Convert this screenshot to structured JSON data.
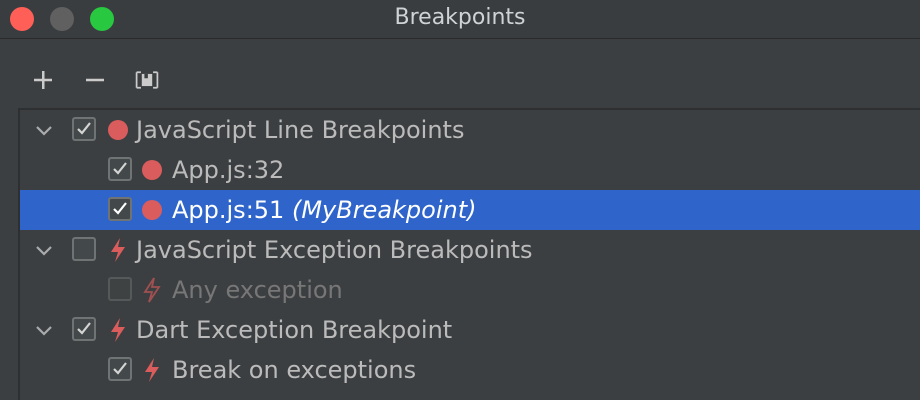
{
  "window": {
    "title": "Breakpoints"
  },
  "toolbar": {
    "add": "+",
    "remove": "−"
  },
  "breakpoints": [
    {
      "label": "JavaScript Line Breakpoints",
      "checked": true,
      "icon": "line-breakpoint-icon"
    },
    {
      "label": "App.js:32",
      "checked": true,
      "icon": "line-breakpoint-icon"
    },
    {
      "label": "App.js:51",
      "extra": "(MyBreakpoint)",
      "checked": true,
      "selected": true,
      "icon": "line-breakpoint-icon"
    },
    {
      "label": "JavaScript Exception Breakpoints",
      "checked": false,
      "icon": "exception-breakpoint-icon"
    },
    {
      "label": "Any exception",
      "checked": false,
      "disabled": true,
      "icon": "exception-breakpoint-icon"
    },
    {
      "label": "Dart Exception Breakpoint",
      "checked": true,
      "icon": "exception-breakpoint-icon"
    },
    {
      "label": "Break on exceptions",
      "checked": true,
      "icon": "exception-breakpoint-icon"
    }
  ]
}
